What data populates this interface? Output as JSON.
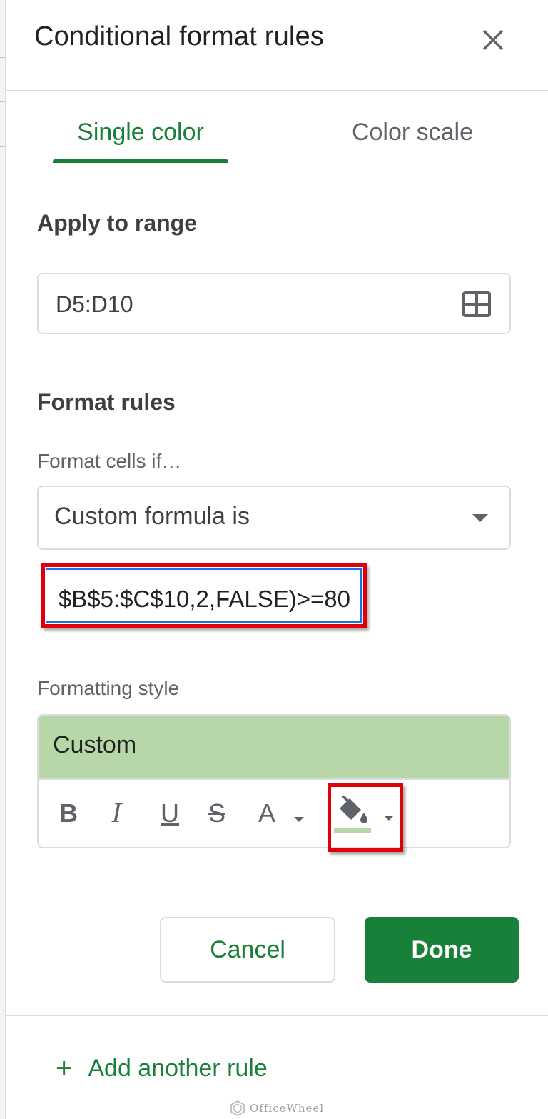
{
  "dialog": {
    "title": "Conditional format rules"
  },
  "tabs": [
    {
      "label": "Single color",
      "active": true
    },
    {
      "label": "Color scale",
      "active": false
    }
  ],
  "apply_to_range": {
    "label": "Apply to range",
    "value": "D5:D10",
    "icon": "grid-select-icon"
  },
  "format_rules": {
    "label": "Format rules",
    "condition_label": "Format cells if…",
    "condition_value": "Custom formula is",
    "formula_value": "$B$5:$C$10,2,FALSE)>=80"
  },
  "formatting_style": {
    "label": "Formatting style",
    "preview_text": "Custom",
    "preview_fill_color": "#b7d7a8",
    "tools": {
      "bold": "B",
      "italic": "I",
      "underline": "U",
      "strikethrough": "S",
      "text_color": "A",
      "fill_color_icon": "fill-color-icon"
    }
  },
  "buttons": {
    "cancel": "Cancel",
    "done": "Done"
  },
  "add_rule": {
    "label": "Add another rule"
  },
  "watermark": "OfficeWheel",
  "colors": {
    "accent": "#188038",
    "highlight_box": "#e0000b",
    "focus_border": "#1a73e8"
  }
}
